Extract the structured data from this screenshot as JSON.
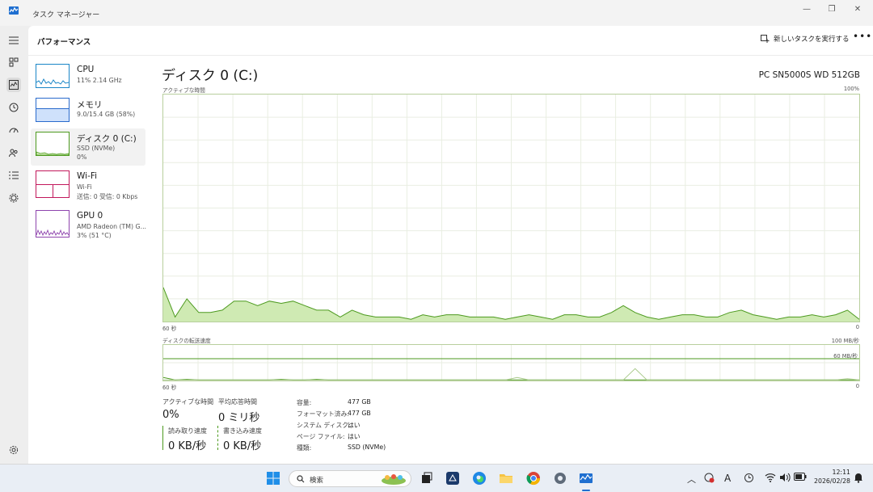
{
  "window": {
    "title": "タスク マネージャー"
  },
  "header": {
    "page_title": "パフォーマンス",
    "run_task": "新しいタスクを実行する"
  },
  "sidebar": [
    {
      "name": "CPU",
      "sub1": "11% 2.14 GHz",
      "sub2": ""
    },
    {
      "name": "メモリ",
      "sub1": "9.0/15.4 GB (58%)",
      "sub2": ""
    },
    {
      "name": "ディスク 0 (C:)",
      "sub1": "SSD (NVMe)",
      "sub2": "0%"
    },
    {
      "name": "Wi-Fi",
      "sub1": "Wi-Fi",
      "sub2": "送信: 0 受信: 0 Kbps"
    },
    {
      "name": "GPU 0",
      "sub1": "AMD Radeon (TM) G...",
      "sub2": "3% (51 °C)"
    }
  ],
  "disk": {
    "title": "ディスク 0 (C:)",
    "model": "PC SN5000S WD 512GB",
    "active_label": "アクティブな時間",
    "active_max": "100%",
    "time_left": "60 秒",
    "time_right": "0",
    "transfer_label": "ディスクの転送速度",
    "transfer_max": "100 MB/秒",
    "transfer_mid": "60 MB/秒",
    "active_series": [
      15,
      2,
      10,
      4,
      4,
      5,
      9,
      9,
      7,
      9,
      8,
      9,
      7,
      5,
      5,
      2,
      5,
      3,
      2,
      2,
      2,
      1,
      3,
      2,
      3,
      3,
      2,
      2,
      2,
      1,
      2,
      3,
      2,
      1,
      3,
      3,
      2,
      2,
      4,
      7,
      4,
      2,
      1,
      2,
      3,
      3,
      2,
      2,
      4,
      5,
      3,
      2,
      1,
      2,
      2,
      3,
      2,
      3,
      5,
      1
    ],
    "transfer_series": [
      5,
      1,
      2,
      1,
      1,
      1,
      1,
      1,
      1,
      1,
      2,
      1,
      1,
      2,
      1,
      1,
      1,
      1,
      1,
      1,
      1,
      1,
      1,
      1,
      1,
      1,
      1,
      1,
      1,
      1,
      1,
      1,
      1,
      1,
      1,
      1,
      1,
      1,
      1,
      1,
      1,
      1,
      1,
      1,
      1,
      1,
      1,
      1,
      1,
      1,
      1,
      1,
      1,
      1,
      1,
      1,
      1,
      1,
      1,
      1
    ],
    "transfer_series_2": [
      1,
      1,
      1,
      1,
      1,
      1,
      1,
      1,
      1,
      1,
      1,
      1,
      1,
      1,
      1,
      1,
      1,
      1,
      1,
      1,
      1,
      1,
      1,
      1,
      1,
      1,
      1,
      1,
      1,
      1,
      5,
      1,
      1,
      1,
      1,
      1,
      1,
      1,
      1,
      1,
      20,
      1,
      1,
      1,
      1,
      1,
      1,
      1,
      1,
      1,
      1,
      1,
      1,
      1,
      1,
      1,
      1,
      1,
      3,
      1
    ],
    "stats": {
      "active_time_label": "アクティブな時間",
      "active_time": "0%",
      "avg_response_label": "平均応答時間",
      "avg_response": "0 ミリ秒",
      "read_label": "読み取り速度",
      "read": "0 KB/秒",
      "write_label": "書き込み速度",
      "write": "0 KB/秒"
    },
    "props": [
      {
        "label": "容量:",
        "value": "477 GB"
      },
      {
        "label": "フォーマット済み:",
        "value": "477 GB"
      },
      {
        "label": "システム ディスク:",
        "value": "はい"
      },
      {
        "label": "ページ ファイル:",
        "value": "はい"
      },
      {
        "label": "種類:",
        "value": "SSD (NVMe)"
      }
    ]
  },
  "taskbar": {
    "search": "検索",
    "time": "12:11",
    "date": "2026/02/28",
    "ime": "A"
  },
  "colors": {
    "disk": "#4d9a1f",
    "disk_fill": "#cfeab3",
    "memory": "#2a6bcc",
    "wifi": "#c2185b",
    "gpu": "#8e44ad",
    "cpu": "#1a86c7"
  }
}
